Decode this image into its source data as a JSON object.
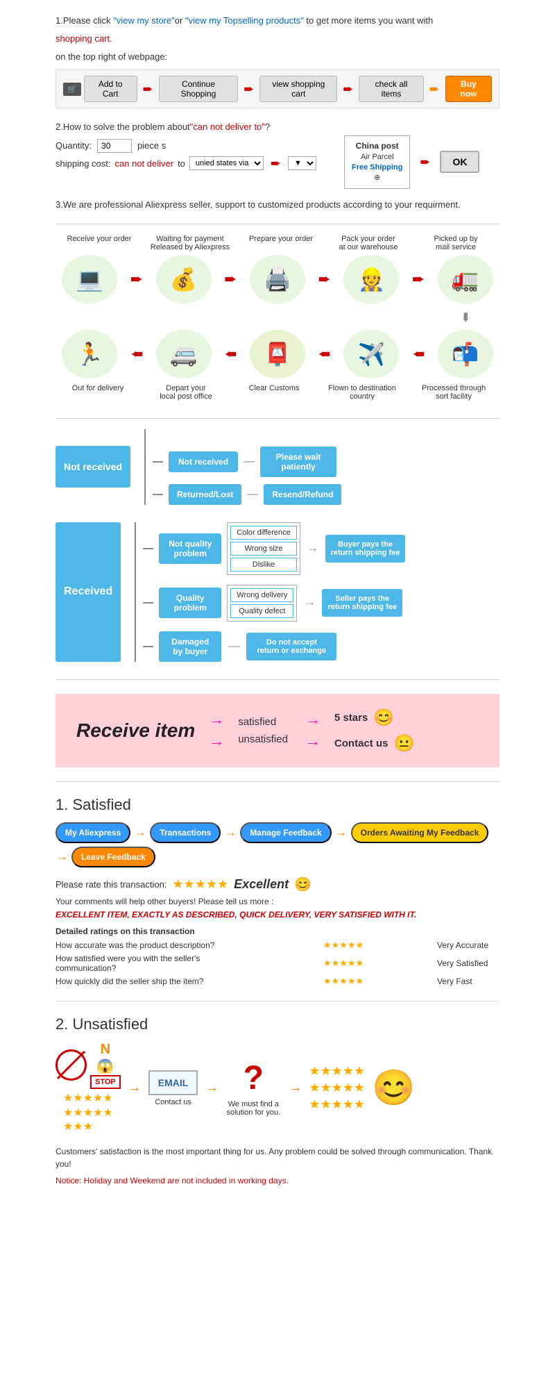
{
  "page": {
    "section1": {
      "text1": "1.Please click ",
      "link1": "\"view my store\"",
      "text2": "or ",
      "link2": "\"view my Topselling products\"",
      "text3": " to get more items you want with",
      "text4": "shopping cart.",
      "text5": "on the top right of webpage:",
      "cart_label": "🛒",
      "add_to_cart": "Add to Cart",
      "continue_shopping": "Continue Shopping",
      "view_shopping_cart": "view shopping cart",
      "check_all_items": "check all items",
      "buy_now": "Buy now"
    },
    "section2": {
      "title": "2.How to solve the problem about",
      "cant_deliver": "\"can not deliver to\"",
      "title2": "?",
      "qty_label": "Quantity:",
      "qty_value": "30",
      "qty_unit": "piece s",
      "shipping_label": "shipping cost:",
      "cant_deliver2": "can not deliver",
      "to_label": " to ",
      "via_label": "unied states via",
      "china_post_title": "China post",
      "air_parcel": "Air Parcel",
      "free_shipping": "Free Shipping",
      "free_circle": "⊕",
      "ok_btn": "OK"
    },
    "section3": {
      "text": "3.We are professional Aliexpress seller, support to customized products according to your requirment."
    },
    "process": {
      "steps_top": [
        {
          "label": "Receive your order",
          "icon": "💻"
        },
        {
          "label": "Waiting for payment Released by Aliexpress",
          "icon": "💰"
        },
        {
          "label": "Prepare your order",
          "icon": "🖨️"
        },
        {
          "label": "Pack your order at our warehouse",
          "icon": "📦"
        },
        {
          "label": "Picked up by mail service",
          "icon": "🚛"
        }
      ],
      "steps_bottom": [
        {
          "label": "Out for delivery",
          "icon": "🏃"
        },
        {
          "label": "Depart your local post office",
          "icon": "🚐"
        },
        {
          "label": "Clear Customs",
          "icon": "📮"
        },
        {
          "label": "Flown to destination country",
          "icon": "✈️"
        },
        {
          "label": "Processed through sort facility",
          "icon": "📬"
        }
      ]
    },
    "not_received": {
      "main": "Not received",
      "branches": [
        {
          "sub": "Not received",
          "result": "Please wait patiently"
        },
        {
          "sub": "Returned/Lost",
          "result": "Resend/Refund"
        }
      ]
    },
    "received": {
      "main": "Received",
      "branches": [
        {
          "sub": "Not quality problem",
          "sub_items": [
            "Color difference",
            "Wrong size",
            "Dislike"
          ],
          "result": "Buyer pays the return shipping fee"
        },
        {
          "sub": "Quality problem",
          "sub_items": [
            "Wrong delivery",
            "Quality defect"
          ],
          "result": "Seller pays the return shipping fee"
        },
        {
          "sub": "Damaged by buyer",
          "result": "Do not accept return or exchange"
        }
      ]
    },
    "pink_section": {
      "title": "Receive item",
      "satisfied": "satisfied",
      "unsatisfied": "unsatisfied",
      "result1": "5 stars",
      "result2": "Contact us",
      "emoji1": "😊",
      "emoji2": "😐"
    },
    "satisfied": {
      "title": "1. Satisfied",
      "steps": [
        {
          "label": "My Aliexpress",
          "style": "blue"
        },
        {
          "label": "Transactions",
          "style": "blue"
        },
        {
          "label": "Manage Feedback",
          "style": "blue"
        },
        {
          "label": "Orders Awaiting My Feedback",
          "style": "yellow"
        },
        {
          "label": "Leave Feedback",
          "style": "orange-p"
        }
      ],
      "rate_label": "Please rate this transaction:",
      "stars": "★★★★★",
      "excellent_label": "Excellent",
      "emoji": "😊",
      "comments": "Your comments will help other buyers! Please tell us more :",
      "review_text": "EXCELLENT ITEM, EXACTLY AS DESCRIBED, QUICK DELIVERY, VERY SATISFIED WITH IT.",
      "detailed_title": "Detailed ratings on this transaction",
      "detail_rows": [
        {
          "label": "How accurate was the product description?",
          "stars": "★★★★★",
          "value": "Very Accurate"
        },
        {
          "label": "How satisfied were you with the seller's communication?",
          "stars": "★★★★★",
          "value": "Very Satisfied"
        },
        {
          "label": "How quickly did the seller ship the item?",
          "stars": "★★★★★",
          "value": "Very Fast"
        }
      ]
    },
    "unsatisfied": {
      "title": "2. Unsatisfied",
      "contact_label": "Contact us",
      "solution_label": "We must find a solution for you.",
      "footer_text": "Customers' satisfaction is the most important thing for us. Any problem could be solved through communication. Thank you!",
      "notice": "Notice: Holiday and Weekend are not included in working days."
    }
  }
}
